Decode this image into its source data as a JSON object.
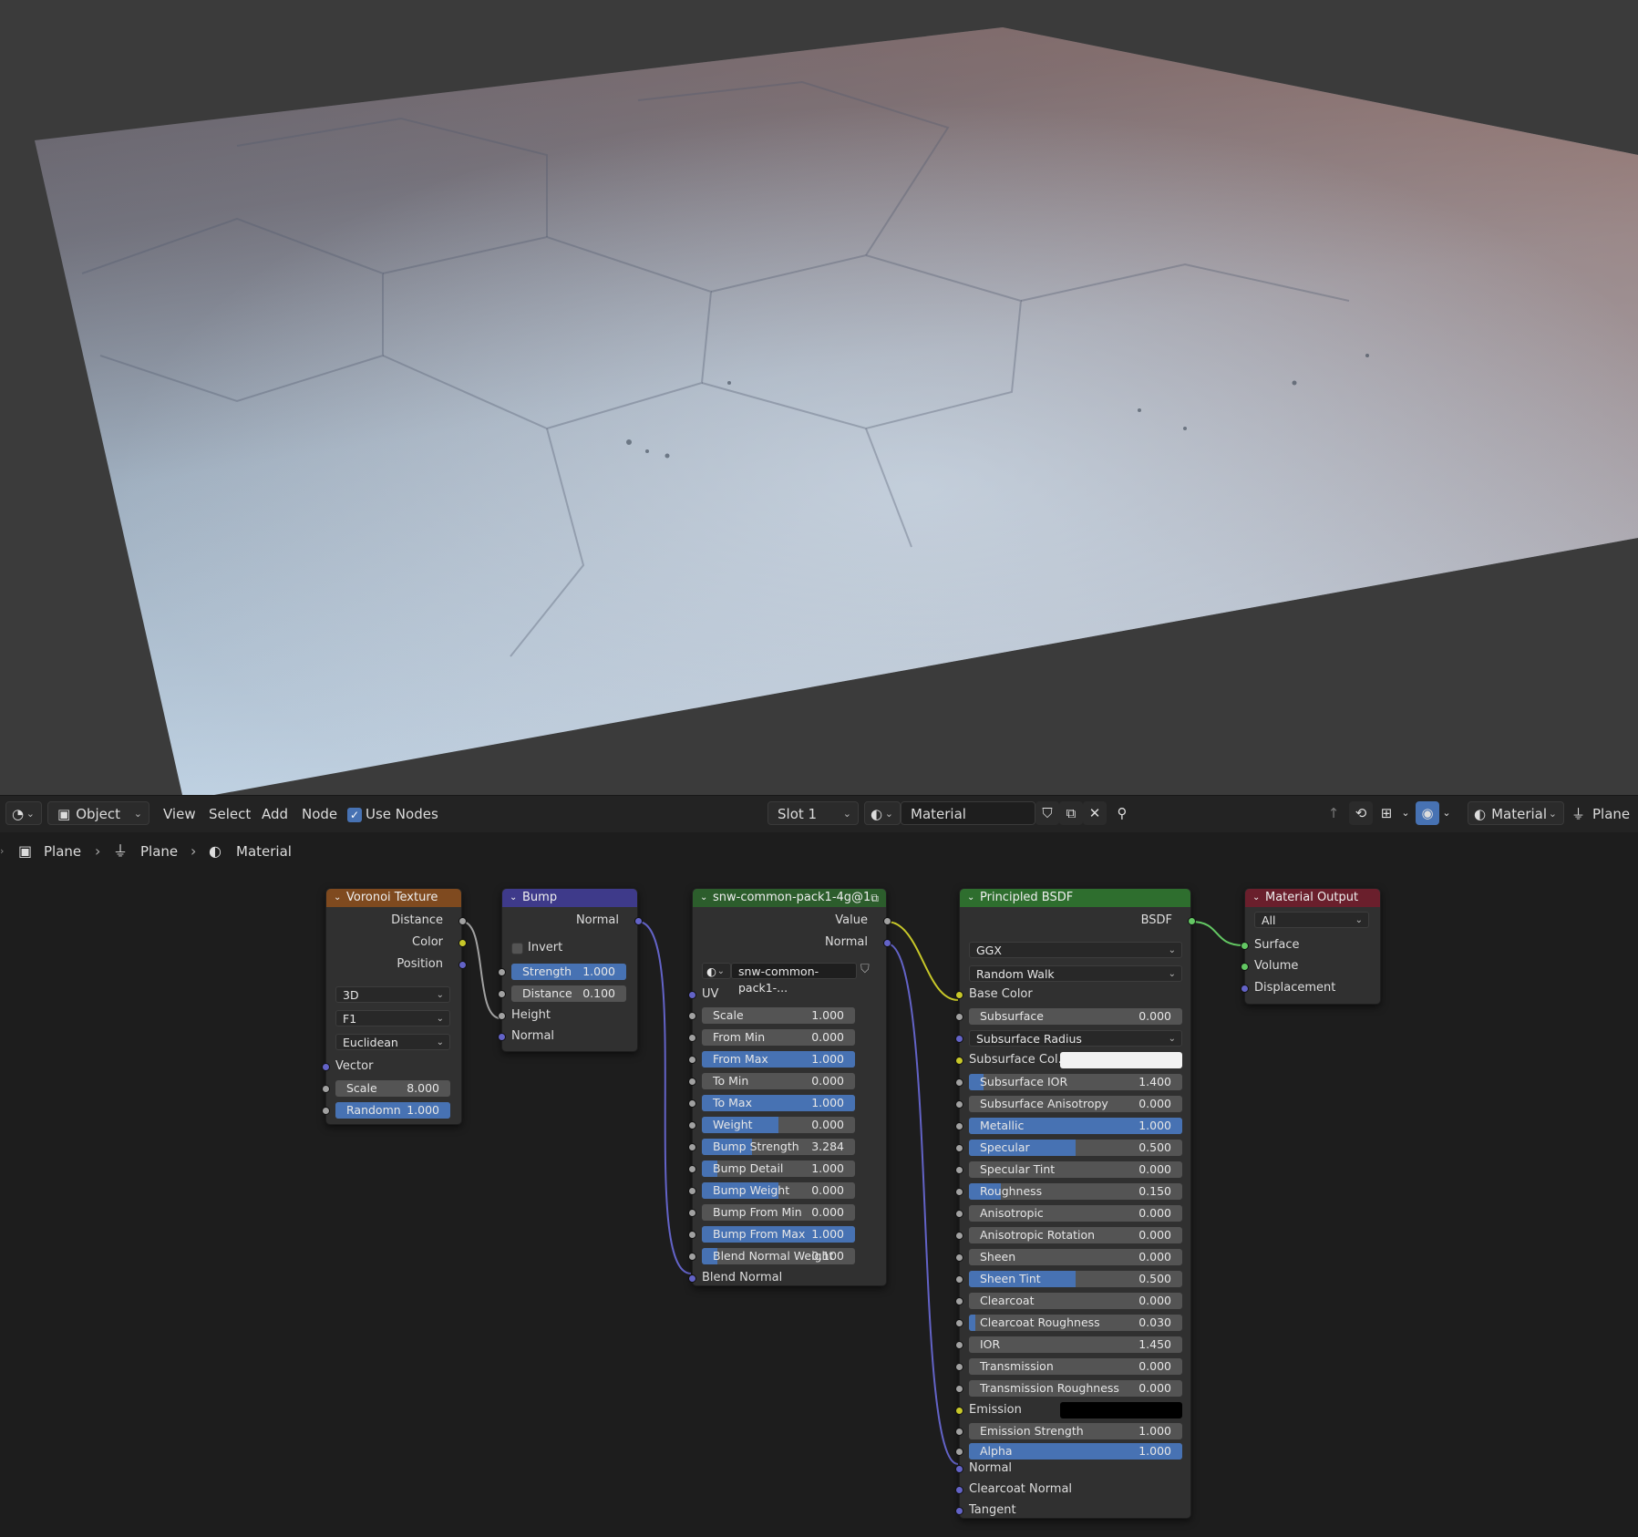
{
  "header": {
    "editor_type_icon": "node-editor-icon",
    "mode_label": "Object",
    "menu": [
      "View",
      "Select",
      "Add",
      "Node"
    ],
    "use_nodes_label": "Use Nodes",
    "use_nodes_checked": true,
    "slot_label": "Slot 1",
    "material_name": "Material",
    "right_material_label": "Material",
    "right_object_label": "Plane"
  },
  "breadcrumbs": [
    "Plane",
    "Plane",
    "Material"
  ],
  "nodes": {
    "voronoi": {
      "title": "Voronoi Texture",
      "outputs": [
        "Distance",
        "Color",
        "Position"
      ],
      "dims": "3D",
      "feature": "F1",
      "metric": "Euclidean",
      "vector_label": "Vector",
      "scale_label": "Scale",
      "scale_value": "8.000",
      "scale_fill": 0,
      "randomn_label": "Randomn",
      "randomn_value": "1.000",
      "randomn_fill": 1
    },
    "bump": {
      "title": "Bump",
      "output": "Normal",
      "invert_label": "Invert",
      "strength_label": "Strength",
      "strength_value": "1.000",
      "strength_fill": 1,
      "distance_label": "Distance",
      "distance_value": "0.100",
      "distance_fill": 0,
      "height_label": "Height",
      "normal_label": "Normal"
    },
    "group": {
      "title": "snw-common-pack1-4g@1",
      "outputs": [
        "Value",
        "Normal"
      ],
      "image_name": "snw-common-pack1-...",
      "uv_label": "UV",
      "fields": [
        {
          "label": "Scale",
          "value": "1.000",
          "fill": 0
        },
        {
          "label": "From Min",
          "value": "0.000",
          "fill": 0
        },
        {
          "label": "From Max",
          "value": "1.000",
          "fill": 1
        },
        {
          "label": "To Min",
          "value": "0.000",
          "fill": 0
        },
        {
          "label": "To Max",
          "value": "1.000",
          "fill": 1
        },
        {
          "label": "Weight",
          "value": "0.000",
          "fill": 0.5
        },
        {
          "label": "Bump Strength",
          "value": "3.284",
          "fill": 0.33
        },
        {
          "label": "Bump Detail",
          "value": "1.000",
          "fill": 0.1
        },
        {
          "label": "Bump Weight",
          "value": "0.000",
          "fill": 0.5
        },
        {
          "label": "Bump From Min",
          "value": "0.000",
          "fill": 0
        },
        {
          "label": "Bump From Max",
          "value": "1.000",
          "fill": 1
        },
        {
          "label": "Blend Normal Weight",
          "value": "0.100",
          "fill": 0.1
        }
      ],
      "blend_normal_label": "Blend Normal"
    },
    "bsdf": {
      "title": "Principled BSDF",
      "output": "BSDF",
      "distribution": "GGX",
      "subsurface_method": "Random Walk",
      "base_color_label": "Base Color",
      "subsurface_label": "Subsurface",
      "subsurface_value": "0.000",
      "subsurface_radius_label": "Subsurface Radius",
      "subsurface_color_label": "Subsurface Col...",
      "subsurface_color": "#f2f2f2",
      "fields": [
        {
          "label": "Subsurface IOR",
          "value": "1.400",
          "fill": 0.07
        },
        {
          "label": "Subsurface Anisotropy",
          "value": "0.000",
          "fill": 0
        },
        {
          "label": "Metallic",
          "value": "1.000",
          "fill": 1
        },
        {
          "label": "Specular",
          "value": "0.500",
          "fill": 0.5
        },
        {
          "label": "Specular Tint",
          "value": "0.000",
          "fill": 0
        },
        {
          "label": "Roughness",
          "value": "0.150",
          "fill": 0.15
        },
        {
          "label": "Anisotropic",
          "value": "0.000",
          "fill": 0
        },
        {
          "label": "Anisotropic Rotation",
          "value": "0.000",
          "fill": 0
        },
        {
          "label": "Sheen",
          "value": "0.000",
          "fill": 0
        },
        {
          "label": "Sheen Tint",
          "value": "0.500",
          "fill": 0.5
        },
        {
          "label": "Clearcoat",
          "value": "0.000",
          "fill": 0
        },
        {
          "label": "Clearcoat Roughness",
          "value": "0.030",
          "fill": 0.03
        },
        {
          "label": "IOR",
          "value": "1.450",
          "fill": 0
        },
        {
          "label": "Transmission",
          "value": "0.000",
          "fill": 0
        },
        {
          "label": "Transmission Roughness",
          "value": "0.000",
          "fill": 0
        }
      ],
      "emission_label": "Emission",
      "emission_color": "#000000",
      "emission_strength_label": "Emission Strength",
      "emission_strength_value": "1.000",
      "alpha_label": "Alpha",
      "alpha_value": "1.000",
      "alpha_fill": 1,
      "inputs_bottom": [
        "Normal",
        "Clearcoat Normal",
        "Tangent"
      ]
    },
    "output": {
      "title": "Material Output",
      "target": "All",
      "inputs": [
        "Surface",
        "Volume",
        "Displacement"
      ]
    }
  },
  "colors": {
    "voronoi_header": "#7f4a1f",
    "bump_header": "#3e3a8a",
    "group_header": "#2c5d2c",
    "bsdf_header": "#2e6e2e",
    "output_header": "#6a1f2c",
    "field_fill": "#4772b3",
    "socket_grey": "#a1a1a1",
    "socket_yellow": "#c7c729",
    "socket_purple": "#6363c7",
    "socket_green": "#63c763"
  }
}
